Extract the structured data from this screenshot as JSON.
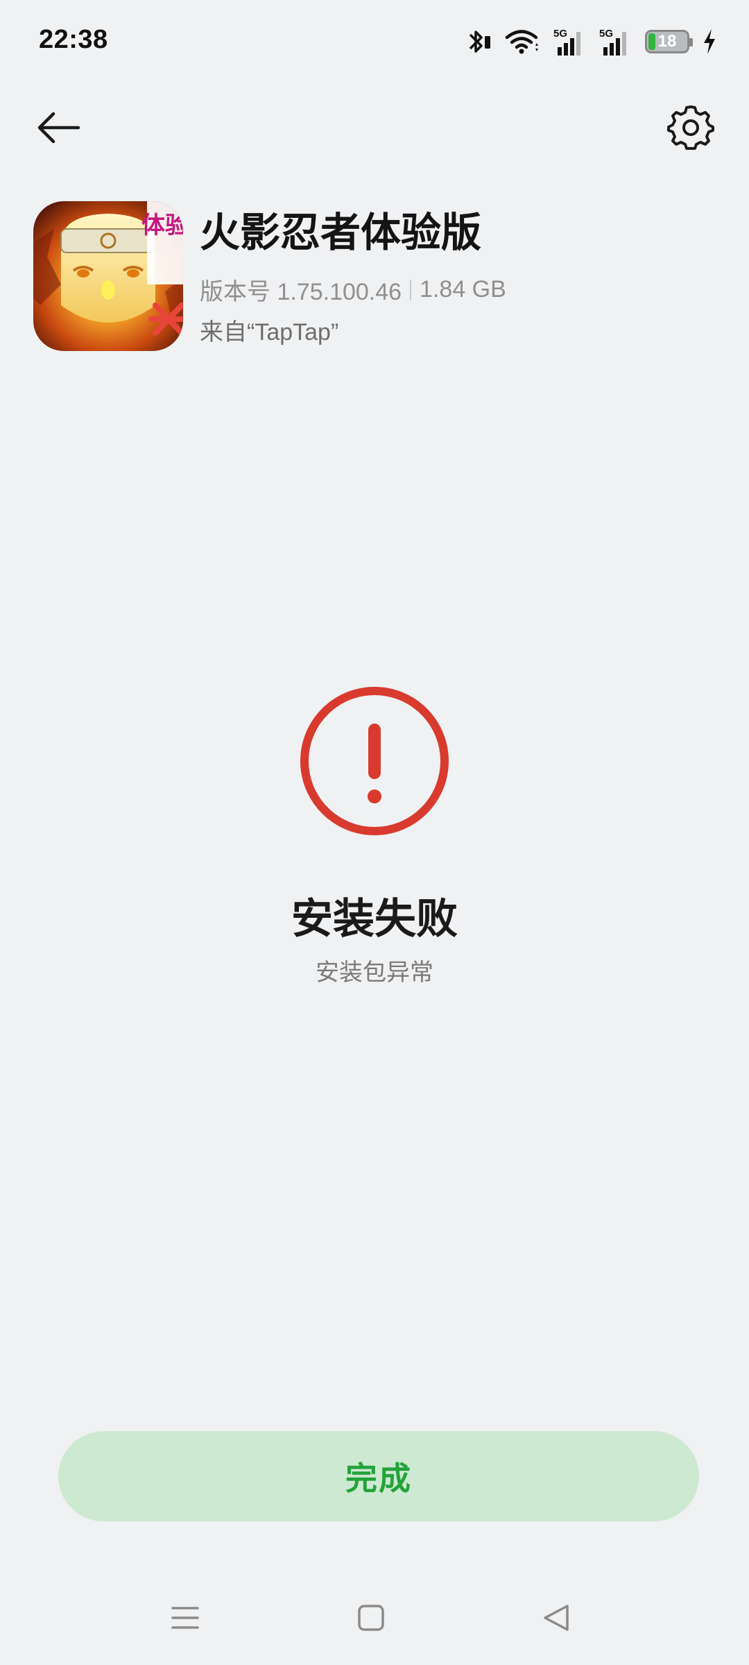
{
  "status_bar": {
    "time": "22:38",
    "icons": [
      "bluetooth-icon",
      "wifi-icon",
      "signal-5g-icon",
      "signal-5g-icon",
      "battery-icon",
      "charging-icon"
    ],
    "signal_label_1": "5G",
    "signal_label_2": "5G",
    "battery_level": "18"
  },
  "toolbar": {
    "back_icon": "arrow-left-icon",
    "settings_icon": "gear-icon"
  },
  "app": {
    "name": "火影忍者体验版",
    "version": "版本号 1.75.100.46",
    "size": "1.84 GB",
    "source": "来自“TapTap”",
    "icon_badge_text": "体验"
  },
  "result": {
    "icon": "error-exclamation-icon",
    "title": "安装失败",
    "subtitle": "安装包异常"
  },
  "actions": {
    "done_label": "完成"
  },
  "nav_bar": {
    "items": [
      "menu-icon",
      "home-icon",
      "back-triangle-icon"
    ]
  },
  "colors": {
    "background": "#f0f1f3",
    "error_red": "#d93a2e",
    "done_button_bg": "#cde9d2",
    "done_button_text": "#23a33a",
    "battery_green": "#2fb43d"
  }
}
